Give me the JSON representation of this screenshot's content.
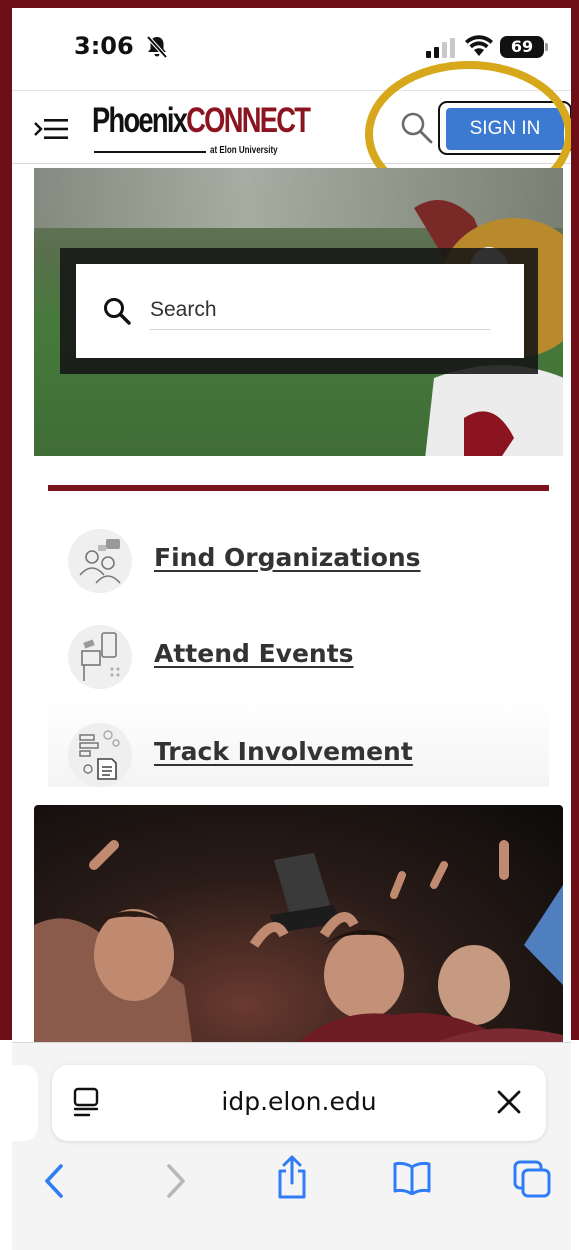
{
  "status_bar": {
    "time": "3:06",
    "battery": "69",
    "icons": [
      "bell-slash-icon",
      "signal-icon",
      "wifi-icon",
      "battery-icon"
    ]
  },
  "header": {
    "logo_primary": "Phoenix",
    "logo_accent": "CONNECT",
    "logo_subtitle": "at Elon University",
    "sign_in_label": "SIGN IN",
    "icons": [
      "menu-icon",
      "search-icon"
    ]
  },
  "hero": {
    "search_placeholder": "Search"
  },
  "quick_links": [
    {
      "label": "Find Organizations",
      "icon": "organizations-icon"
    },
    {
      "label": "Attend Events",
      "icon": "events-icon"
    },
    {
      "label": "Track Involvement",
      "icon": "involvement-icon"
    }
  ],
  "browser": {
    "url": "idp.elon.edu",
    "icons": [
      "reader-icon",
      "close-icon",
      "back-icon",
      "forward-icon",
      "share-icon",
      "bookmarks-icon",
      "tabs-icon"
    ]
  },
  "colors": {
    "brand_maroon": "#7c1420",
    "sign_in_blue": "#3c79d0",
    "annotation_gold": "#d8a81c",
    "ios_blue": "#2f7cf6"
  }
}
